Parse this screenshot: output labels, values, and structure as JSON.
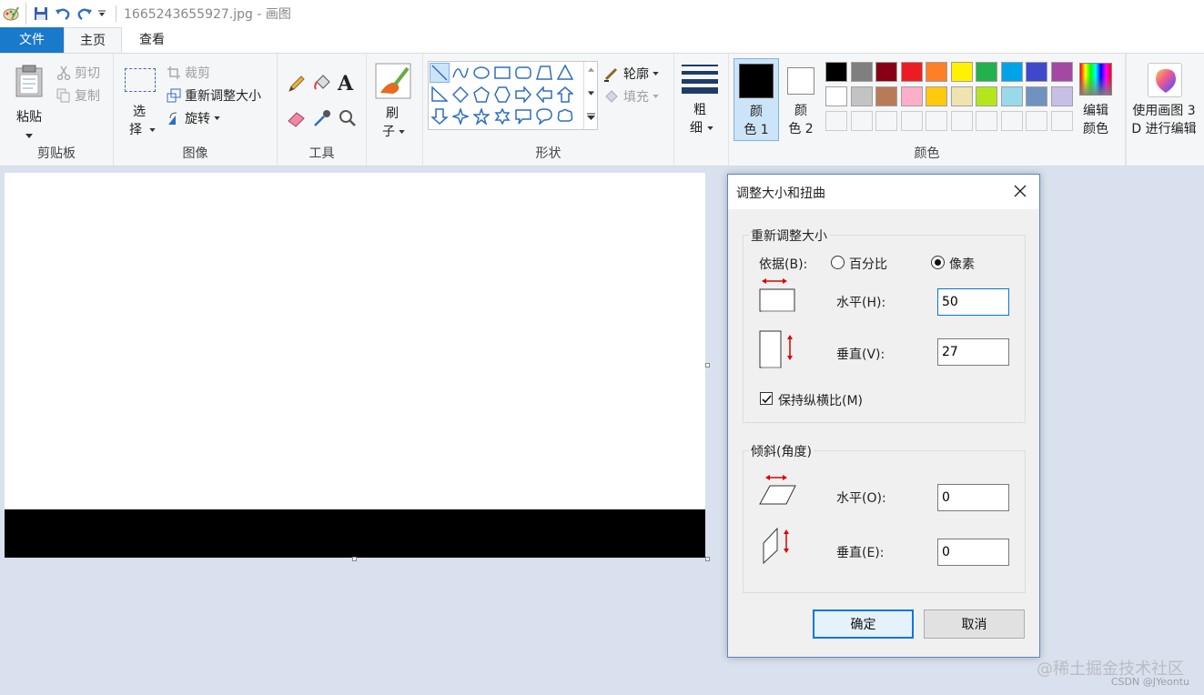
{
  "window": {
    "title": "1665243655927.jpg - 画图"
  },
  "tabs": {
    "file": "文件",
    "home": "主页",
    "view": "查看"
  },
  "clipboard": {
    "paste": "粘贴",
    "cut": "剪切",
    "copy": "复制",
    "label": "剪贴板"
  },
  "image": {
    "select_line1": "选",
    "select_line2": "择",
    "crop": "裁剪",
    "resize": "重新调整大小",
    "rotate": "旋转",
    "label": "图像"
  },
  "tools": {
    "label": "工具",
    "text_icon": "A"
  },
  "brushes": {
    "line1": "刷",
    "line2": "子"
  },
  "shapes": {
    "outline": "轮廓",
    "fill": "填充",
    "label": "形状"
  },
  "size": {
    "line1": "粗",
    "line2": "细"
  },
  "colors": {
    "color1_line1": "颜",
    "color1_line2": "色 1",
    "color2_line1": "颜",
    "color2_line2": "色 2",
    "edit_line1": "编辑",
    "edit_line2": "颜色",
    "label": "颜色",
    "color1": "#000000",
    "color2": "#ffffff",
    "row1": [
      "#000000",
      "#7f7f7f",
      "#880015",
      "#ed1c24",
      "#ff7f27",
      "#fff200",
      "#22b14c",
      "#00a2e8",
      "#3f48cc",
      "#a349a4"
    ],
    "row2": [
      "#ffffff",
      "#c3c3c3",
      "#b97a57",
      "#ffaec9",
      "#ffc90e",
      "#efe4b0",
      "#b5e61d",
      "#99d9ea",
      "#7092be",
      "#c8bfe7"
    ]
  },
  "paint3d": {
    "line1": "使用画图 3",
    "line2": "D 进行编辑"
  },
  "dialog": {
    "title": "调整大小和扭曲",
    "resize_section": "重新调整大小",
    "by_label": "依据(B):",
    "by_underline": "B",
    "percent": "百分比",
    "pixels": "像素",
    "horizontal": "水平(H):",
    "horizontal_value": "50",
    "vertical": "垂直(V):",
    "vertical_value": "27",
    "keep_ratio": "保持纵横比(M)",
    "skew_section": "倾斜(角度)",
    "skew_horizontal": "水平(O):",
    "skew_horizontal_value": "0",
    "skew_vertical": "垂直(E):",
    "skew_vertical_value": "0",
    "ok": "确定",
    "cancel": "取消"
  },
  "watermark": {
    "main": "@稀土掘金技术社区",
    "sub": "CSDN @JYeontu"
  }
}
